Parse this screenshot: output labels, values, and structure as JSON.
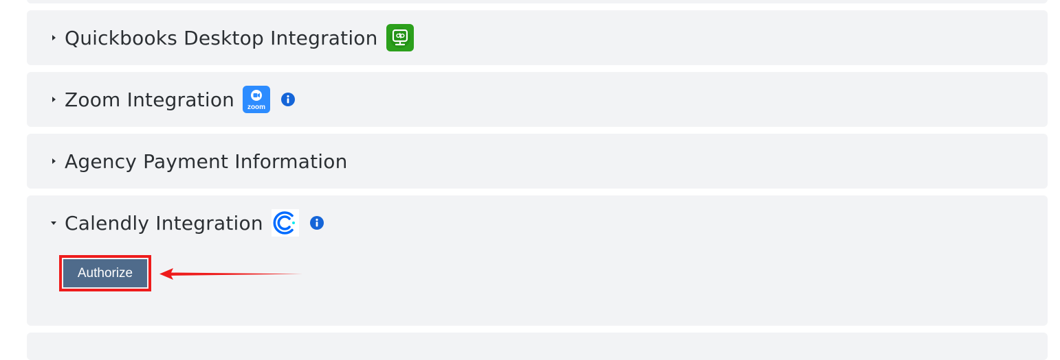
{
  "panels": [
    {
      "title": "Quickbooks Desktop Integration",
      "expanded": false,
      "logo": "quickbooks-desktop-logo",
      "has_info": false
    },
    {
      "title": "Zoom Integration",
      "expanded": false,
      "logo": "zoom-logo",
      "logo_text": "zoom",
      "has_info": true
    },
    {
      "title": "Agency Payment Information",
      "expanded": false,
      "logo": null,
      "has_info": false
    },
    {
      "title": "Calendly Integration",
      "expanded": true,
      "logo": "calendly-logo",
      "has_info": true,
      "content": {
        "authorize_label": "Authorize"
      }
    }
  ],
  "annotations": {
    "highlight_color": "#ee1c1c",
    "arrow_color": "#ee1c1c"
  },
  "colors": {
    "panel_bg": "#f2f3f5",
    "info_icon": "#1565d8",
    "authorize_button": "#4f6b8b",
    "quickbooks_green": "#2ca01c",
    "zoom_blue": "#2d8cff",
    "calendly_blue": "#006bff"
  }
}
